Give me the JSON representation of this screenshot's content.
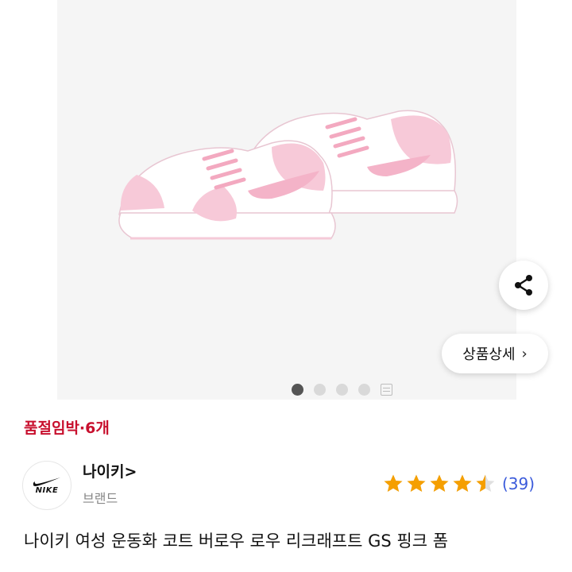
{
  "product": {
    "stock_status": "품절임박·6개",
    "brand_name": "나이키>",
    "brand_label": "브랜드",
    "brand_logo_text": "NIKE",
    "rating": 4.5,
    "rating_max": 5,
    "review_count": "(39)",
    "title": "나이키 여성 운동화 코트 버로우 로우 리크래프트 GS 핑크 폼"
  },
  "gallery": {
    "image_count": 4,
    "active_index": 0,
    "detail_button_label": "상품상세",
    "share_icon": "share-icon"
  },
  "colors": {
    "stock_status": "#c8102e",
    "star": "#f59f00",
    "review_count": "#3b5bdb",
    "gallery_bg": "#f5f5f5"
  }
}
